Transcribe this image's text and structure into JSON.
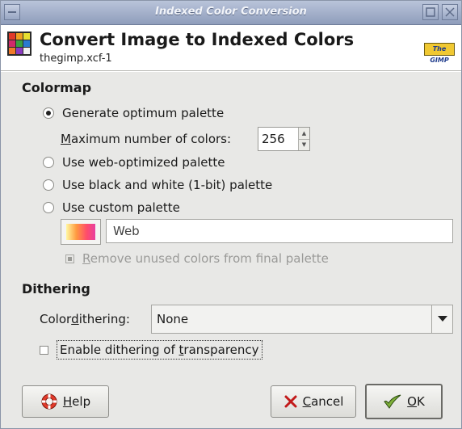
{
  "window": {
    "title": "Indexed Color Conversion"
  },
  "header": {
    "title": "Convert Image to Indexed Colors",
    "subtitle": "thegimp.xcf-1",
    "logo_text": "The GIMP"
  },
  "colormap": {
    "section_title": "Colormap",
    "options": [
      {
        "label": "Generate optimum palette",
        "checked": true
      },
      {
        "label": "Use web-optimized palette",
        "checked": false
      },
      {
        "label": "Use black and white (1-bit) palette",
        "checked": false
      },
      {
        "label": "Use custom palette",
        "checked": false
      }
    ],
    "max_colors": {
      "label_mnemonic": "M",
      "label_rest": "aximum number of colors:",
      "value": "256"
    },
    "custom_palette_name": "Web",
    "remove_unused": {
      "label_mnemonic": "R",
      "label_rest": "emove unused colors from final palette",
      "checked": true,
      "enabled": false
    }
  },
  "dithering": {
    "section_title": "Dithering",
    "color_dithering": {
      "label_pre": "Color ",
      "label_mnemonic": "d",
      "label_post": "ithering:",
      "value": "None"
    },
    "transparency": {
      "label_pre": "Enable dithering of ",
      "label_mnemonic": "t",
      "label_post": "ransparency",
      "checked": false
    }
  },
  "buttons": {
    "help": {
      "mnemonic": "H",
      "rest": "elp"
    },
    "cancel": {
      "mnemonic": "C",
      "rest": "ancel"
    },
    "ok": {
      "mnemonic": "O",
      "rest": "K"
    }
  },
  "colors": {
    "titlebar": "#a4b1cc",
    "window_bg": "#e8e8e6",
    "header_bg": "#ffffff"
  }
}
